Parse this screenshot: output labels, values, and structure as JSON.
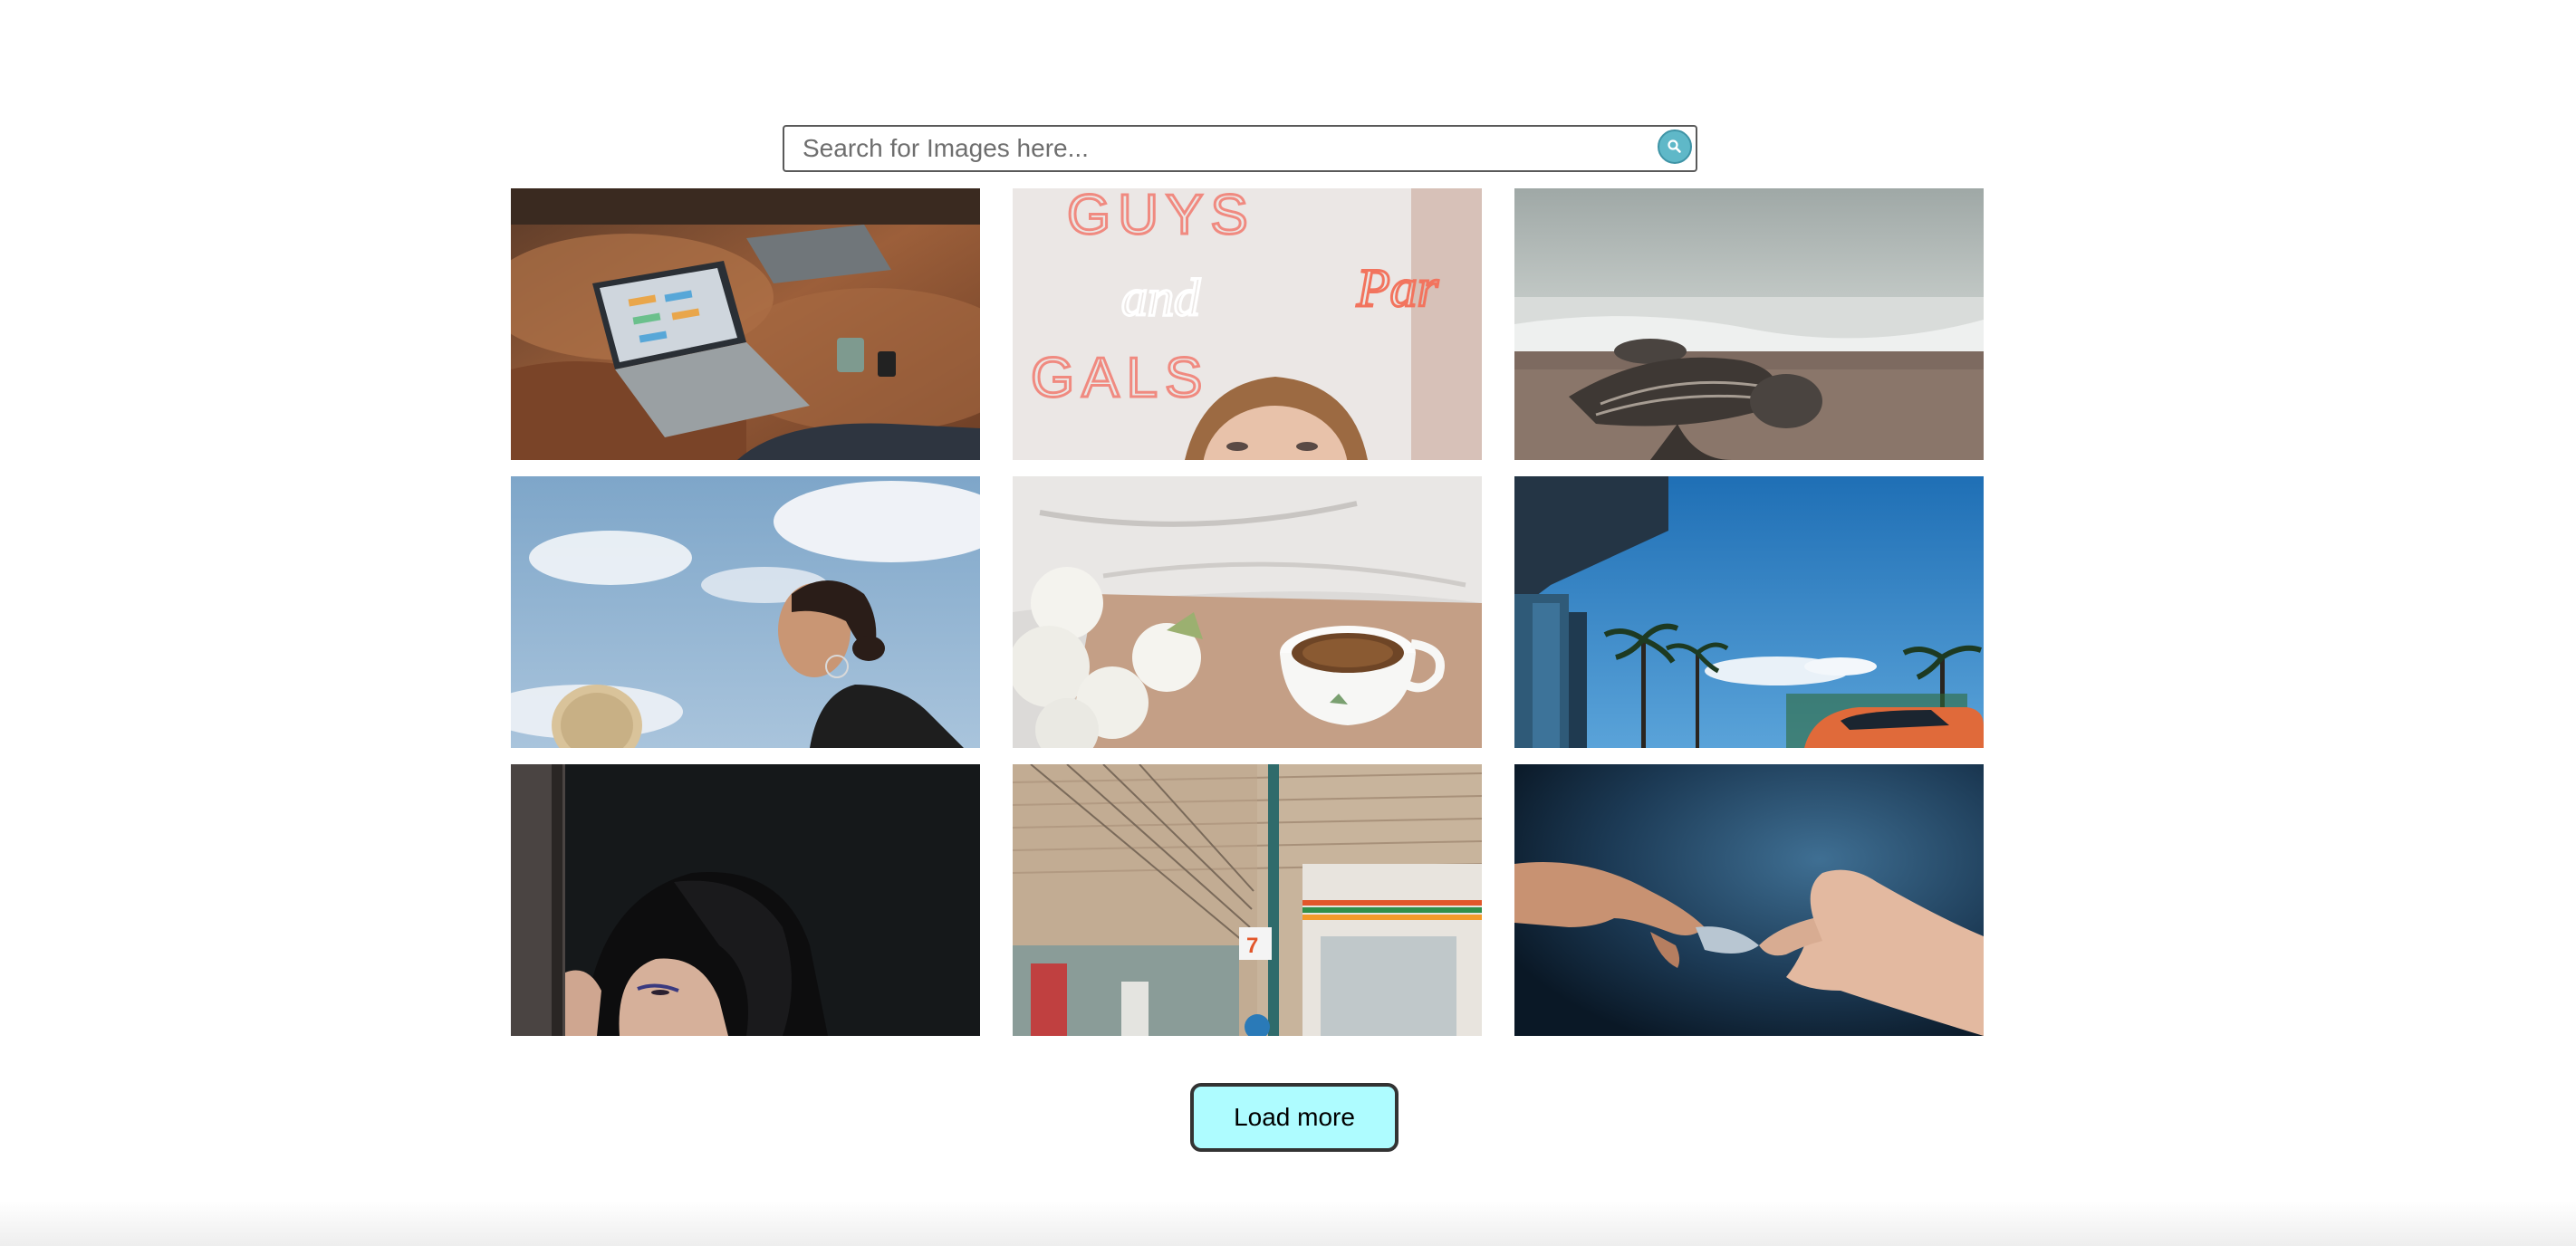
{
  "search": {
    "placeholder": "Search for Images here...",
    "value": "",
    "button_icon": "search-icon"
  },
  "gallery": {
    "images": [
      {
        "subject": "laptop-on-leather-couch"
      },
      {
        "subject": "neon-sign-woman"
      },
      {
        "subject": "turtle-on-beach"
      },
      {
        "subject": "women-against-sky"
      },
      {
        "subject": "coffee-and-flowers"
      },
      {
        "subject": "palm-trees-and-car"
      },
      {
        "subject": "woman-in-dark"
      },
      {
        "subject": "convenience-store-street"
      },
      {
        "subject": "hands-passing-object"
      }
    ]
  },
  "load_more": {
    "label": "Load more"
  },
  "colors": {
    "search_button": "#5fb8c8",
    "load_more_bg": "#aefcff",
    "border": "#333333"
  }
}
